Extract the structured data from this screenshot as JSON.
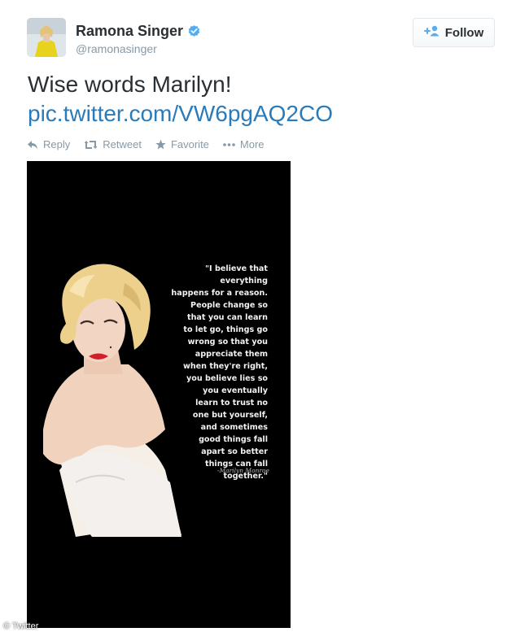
{
  "user": {
    "name": "Ramona Singer",
    "handle": "@ramonasinger",
    "verified_icon": "verified-badge-icon",
    "avatar_icon": "profile-photo"
  },
  "follow_button": {
    "label": "Follow",
    "icon": "add-user-icon"
  },
  "tweet": {
    "text": "Wise words Marilyn!",
    "link": "pic.twitter.com/VW6pgAQ2CO"
  },
  "actions": [
    {
      "label": "Reply",
      "icon": "reply-icon"
    },
    {
      "label": "Retweet",
      "icon": "retweet-icon"
    },
    {
      "label": "Favorite",
      "icon": "star-icon"
    },
    {
      "label": "More",
      "icon": "ellipsis-icon"
    }
  ],
  "media": {
    "quote": "\"I believe that everything\nhappens for a reason.\nPeople change so\nthat you can learn\nto let go, things go\nwrong so that you\nappreciate them\nwhen they're right,\nyou believe lies so\nyou eventually\nlearn to trust no\none but yourself,\nand sometimes\ngood things fall\napart so better\nthings can fall\ntogether.\"",
    "signature": "-Marilyn Monroe",
    "watermark": "© Twitter"
  },
  "colors": {
    "link": "#2b7bb9",
    "verified": "#55acee",
    "muted": "#8899a6",
    "text": "#292f33"
  }
}
